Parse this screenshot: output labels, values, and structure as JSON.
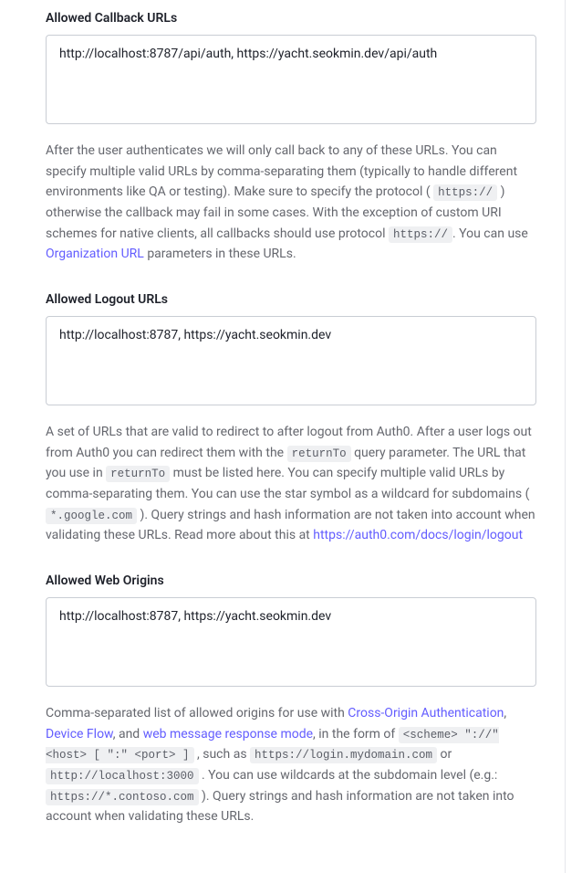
{
  "sections": {
    "callback": {
      "label": "Allowed Callback URLs",
      "value": "http://localhost:8787/api/auth, https://yacht.seokmin.dev/api/auth",
      "help_pre_1": "After the user authenticates we will only call back to any of these URLs. You can specify multiple valid URLs by comma-separating them (typically to handle different environments like QA or testing). Make sure to specify the protocol (",
      "code_1": "https://",
      "help_mid_1": ") otherwise the callback may fail in some cases. With the exception of custom URI schemes for native clients, all callbacks should use protocol ",
      "code_2": "https://",
      "help_mid_2": ". You can use ",
      "link_text": "Organization URL",
      "help_end": " parameters in these URLs."
    },
    "logout": {
      "label": "Allowed Logout URLs",
      "value": "http://localhost:8787, https://yacht.seokmin.dev",
      "help_pre_1": "A set of URLs that are valid to redirect to after logout from Auth0. After a user logs out from Auth0 you can redirect them with the ",
      "code_1": "returnTo",
      "help_mid_1": " query parameter. The URL that you use in ",
      "code_2": "returnTo",
      "help_mid_2": " must be listed here. You can specify multiple valid URLs by comma-separating them. You can use the star symbol as a wildcard for subdomains (",
      "code_3": "*.google.com",
      "help_mid_3": "). Query strings and hash information are not taken into account when validating these URLs. Read more about this at ",
      "link_text": "https://auth0.com/docs/login/logout"
    },
    "origins": {
      "label": "Allowed Web Origins",
      "value": "http://localhost:8787, https://yacht.seokmin.dev",
      "help_pre_1": "Comma-separated list of allowed origins for use with ",
      "link_1": "Cross-Origin Authentication",
      "sep_1": ", ",
      "link_2": "Device Flow",
      "sep_2": ", and ",
      "link_3": "web message response mode",
      "help_mid_1": ", in the form of ",
      "code_1": "<scheme> \"://\" <host> [ \":\" <port> ]",
      "help_mid_2": ", such as ",
      "code_2": "https://login.mydomain.com",
      "or_text": " or ",
      "code_3": "http://localhost:3000",
      "help_mid_3": ". You can use wildcards at the subdomain level (e.g.: ",
      "code_4": "https://*.contoso.com",
      "help_end": "). Query strings and hash information are not taken into account when validating these URLs."
    }
  }
}
